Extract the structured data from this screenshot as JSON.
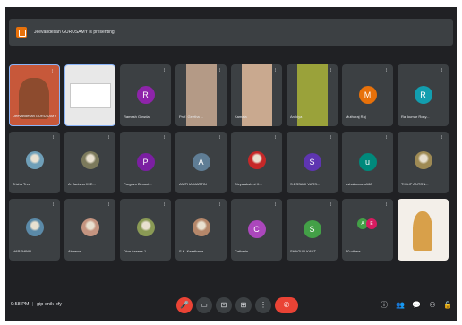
{
  "banner": {
    "text": "Jeevandesan GURUSAMY is presenting"
  },
  "tiles": [
    {
      "name": "Jeevandesan GURUSAMY",
      "kind": "self",
      "color": "#c7583a"
    },
    {
      "name": "",
      "kind": "screen",
      "color": "#e8e8e8"
    },
    {
      "name": "Ramesh Gowda",
      "initial": "R",
      "color": "#8e24aa"
    },
    {
      "name": "Prof. Geetha ...",
      "kind": "cam",
      "color": "#b49a86"
    },
    {
      "name": "Kamala",
      "kind": "cam",
      "color": "#c9a98f"
    },
    {
      "name": "Arokiya",
      "kind": "cam",
      "color": "#9aa23a"
    },
    {
      "name": "Muthuraj Raj",
      "initial": "M",
      "color": "#e8710a"
    },
    {
      "name": "Raj kumar Rosy...",
      "initial": "R",
      "color": "#129eaf"
    },
    {
      "name": "Trisha Tree",
      "kind": "photo",
      "color": "#6f9fb8"
    },
    {
      "name": "A. Janisha XI E...",
      "kind": "photo",
      "color": "#7c7a5c"
    },
    {
      "name": "Pargevo Benazi...",
      "initial": "P",
      "color": "#7b1fa2"
    },
    {
      "name": "ANITHA MARTIN",
      "initial": "A",
      "color": "#5f7d95"
    },
    {
      "name": "Divyalakshmi K...",
      "kind": "photo",
      "color": "#c62828"
    },
    {
      "name": "S.ESSAKI VARS...",
      "initial": "S",
      "color": "#5e35b1"
    },
    {
      "name": "ushakumar s168",
      "initial": "u",
      "color": "#00897b"
    },
    {
      "name": "THILIP ANTON...",
      "kind": "photo",
      "color": "#9e8a54"
    },
    {
      "name": "HARSHINI I",
      "kind": "photo",
      "color": "#5b8aa8"
    },
    {
      "name": "Abeema",
      "kind": "photo",
      "color": "#c49480"
    },
    {
      "name": "Diva Aseera J",
      "kind": "photo",
      "color": "#8a9a55"
    },
    {
      "name": "S.K. Keerthana",
      "kind": "photo",
      "color": "#b5876a"
    },
    {
      "name": "Catherin",
      "initial": "C",
      "color": "#ab47bc"
    },
    {
      "name": "SHAGUN KANT...",
      "initial": "S",
      "color": "#43a047"
    },
    {
      "name": "40 others",
      "kind": "others",
      "color": "#3c4043"
    },
    {
      "name": "",
      "kind": "selfcam",
      "color": "#d8a04a"
    }
  ],
  "footer": {
    "time": "9:58 PM",
    "separator": "|",
    "code": "gip-snik-pfy"
  },
  "controls": {
    "mic": "🎤",
    "cam": "▭",
    "cc": "⊡",
    "present": "⊞",
    "more": "⋮",
    "end": "✆"
  },
  "right_icons": {
    "info": "ⓘ",
    "people": "👥",
    "chat": "💬",
    "activities": "⚇",
    "lock": "🔒"
  },
  "others_initials": [
    "A",
    "E"
  ]
}
